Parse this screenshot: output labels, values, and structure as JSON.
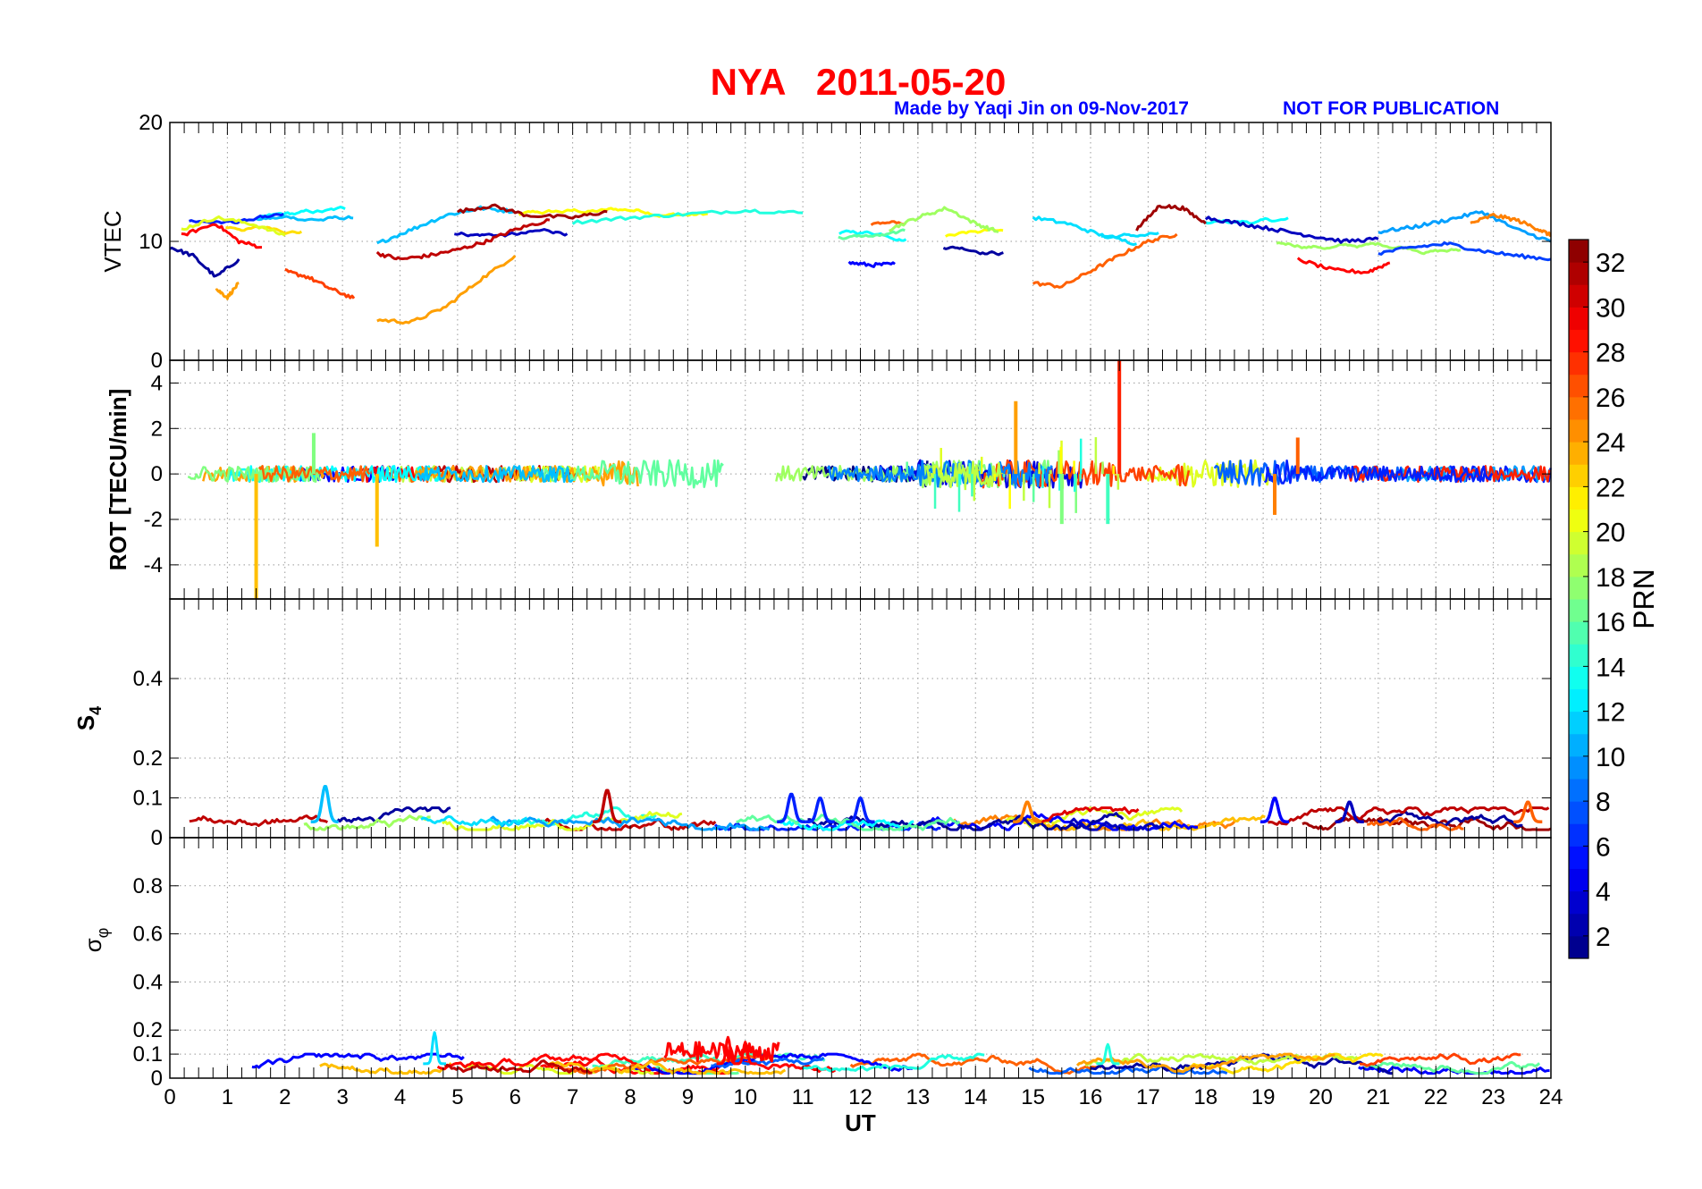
{
  "figure": {
    "title": "NYA   2011-05-20",
    "credit": "Made by Yaqi Jin on 09-Nov-2017",
    "notice": "NOT FOR PUBLICATION",
    "title_color": "#ff0000",
    "credit_color": "#0000ff"
  },
  "colorbar": {
    "label": "PRN",
    "range": [
      1,
      33
    ],
    "ticks": [
      "2",
      "4",
      "6",
      "8",
      "10",
      "12",
      "14",
      "16",
      "18",
      "20",
      "22",
      "24",
      "26",
      "28",
      "30",
      "32"
    ],
    "colormap": "jet"
  },
  "chart_data": [
    {
      "type": "line",
      "panel": "vtec",
      "ylabel": "VTEC",
      "ylim": [
        0,
        20
      ],
      "yticks": [
        "0",
        "10",
        "20"
      ],
      "xlim": [
        0,
        24
      ],
      "grid": true,
      "series": [
        {
          "prn": 2,
          "x": [
            0.0,
            0.4,
            0.8,
            1.2
          ],
          "y": [
            9.5,
            8.8,
            7.0,
            8.5
          ]
        },
        {
          "prn": 5,
          "x": [
            11.8,
            12.2,
            12.6
          ],
          "y": [
            8.2,
            8.0,
            8.1
          ]
        },
        {
          "prn": 11,
          "x": [
            3.6,
            4.2,
            4.8,
            5.4,
            6.0
          ],
          "y": [
            9.8,
            11.0,
            12.2,
            12.8,
            12.5
          ]
        },
        {
          "prn": 14,
          "x": [
            7.0,
            8.0,
            9.0,
            10.0,
            11.0
          ],
          "y": [
            11.6,
            12.0,
            12.3,
            12.6,
            12.4
          ]
        },
        {
          "prn": 20,
          "x": [
            0.2,
            0.8,
            1.4,
            2.0
          ],
          "y": [
            11.0,
            12.0,
            11.5,
            10.5
          ]
        },
        {
          "prn": 24,
          "x": [
            3.6,
            4.2,
            4.8,
            5.4,
            6.0
          ],
          "y": [
            3.4,
            3.2,
            4.5,
            6.8,
            8.8
          ]
        },
        {
          "prn": 24,
          "x": [
            0.8,
            1.0,
            1.2
          ],
          "y": [
            6.0,
            5.3,
            6.5
          ]
        },
        {
          "prn": 27,
          "x": [
            2.0,
            2.4,
            2.8,
            3.2
          ],
          "y": [
            7.5,
            7.0,
            6.0,
            5.2
          ]
        },
        {
          "prn": 29,
          "x": [
            0.2,
            0.8,
            1.2,
            1.6
          ],
          "y": [
            10.5,
            11.5,
            10.0,
            9.5
          ]
        },
        {
          "prn": 31,
          "x": [
            3.6,
            4.0,
            4.5,
            5.0,
            5.5,
            6.0,
            6.6
          ],
          "y": [
            9.0,
            8.5,
            8.8,
            9.3,
            10.0,
            11.0,
            11.8
          ]
        },
        {
          "prn": 32,
          "x": [
            5.0,
            5.6,
            6.2,
            7.0,
            7.6
          ],
          "y": [
            12.5,
            13.0,
            12.2,
            12.0,
            12.5
          ]
        },
        {
          "prn": 26,
          "x": [
            15.0,
            15.5,
            16.0,
            16.5,
            17.0,
            17.5
          ],
          "y": [
            6.5,
            6.2,
            7.5,
            8.8,
            10.0,
            10.6
          ]
        },
        {
          "prn": 18,
          "x": [
            12.5,
            13.0,
            13.5,
            14.0,
            14.4
          ],
          "y": [
            11.0,
            12.0,
            12.8,
            11.5,
            10.8
          ]
        },
        {
          "prn": 12,
          "x": [
            15.0,
            15.6,
            16.2,
            16.8
          ],
          "y": [
            12.0,
            11.5,
            10.5,
            9.8
          ]
        },
        {
          "prn": 3,
          "x": [
            18.0,
            18.6,
            19.2,
            19.8,
            20.4,
            21.0
          ],
          "y": [
            12.0,
            11.5,
            11.0,
            10.5,
            10.0,
            10.2
          ]
        },
        {
          "prn": 29,
          "x": [
            19.6,
            20.2,
            20.8,
            21.2
          ],
          "y": [
            8.5,
            7.6,
            7.4,
            8.2
          ]
        },
        {
          "prn": 10,
          "x": [
            21.0,
            21.6,
            22.2,
            22.8,
            23.4,
            24.0
          ],
          "y": [
            10.8,
            11.2,
            11.8,
            12.5,
            11.0,
            10.0
          ]
        },
        {
          "prn": 25,
          "x": [
            22.6,
            23.0,
            23.4,
            23.8,
            24.0
          ],
          "y": [
            11.5,
            12.2,
            11.8,
            11.0,
            10.5
          ]
        },
        {
          "prn": 7,
          "x": [
            21.0,
            21.6,
            22.2,
            22.8,
            23.4,
            24.0
          ],
          "y": [
            9.0,
            9.5,
            9.8,
            9.2,
            8.8,
            8.5
          ]
        },
        {
          "prn": 32,
          "x": [
            16.8,
            17.2,
            17.6,
            18.0
          ],
          "y": [
            11.0,
            13.0,
            12.8,
            11.5
          ]
        }
      ]
    },
    {
      "type": "line",
      "panel": "rot",
      "ylabel": "ROT [TECU/min]",
      "ylim": [
        -5.5,
        5.0
      ],
      "yticks": [
        "-4",
        "-2",
        "0",
        "2",
        "4"
      ],
      "xlim": [
        0,
        24
      ],
      "grid": true,
      "spikes": [
        {
          "prn": 23,
          "x": 1.5,
          "y": -5.5
        },
        {
          "prn": 23,
          "x": 3.6,
          "y": -3.2
        },
        {
          "prn": 24,
          "x": 14.7,
          "y": 3.2
        },
        {
          "prn": 28,
          "x": 16.5,
          "y": 5.0
        },
        {
          "prn": 17,
          "x": 2.5,
          "y": 1.8
        },
        {
          "prn": 17,
          "x": 15.5,
          "y": -2.2
        },
        {
          "prn": 15,
          "x": 16.3,
          "y": -2.2
        },
        {
          "prn": 25,
          "x": 19.2,
          "y": -1.8
        },
        {
          "prn": 26,
          "x": 19.6,
          "y": 1.6
        }
      ]
    },
    {
      "type": "line",
      "panel": "s4",
      "ylabel": "S4",
      "ylim": [
        0,
        0.6
      ],
      "yticks": [
        "0",
        "0.1",
        "0.2",
        "0.4"
      ],
      "xlim": [
        0,
        24
      ],
      "grid": true,
      "bumps": [
        {
          "prn": 11,
          "x": 2.7,
          "y": 0.13
        },
        {
          "prn": 31,
          "x": 7.6,
          "y": 0.12
        },
        {
          "prn": 6,
          "x": 10.8,
          "y": 0.11
        },
        {
          "prn": 6,
          "x": 11.3,
          "y": 0.1
        },
        {
          "prn": 6,
          "x": 12.0,
          "y": 0.1
        },
        {
          "prn": 25,
          "x": 14.9,
          "y": 0.09
        },
        {
          "prn": 5,
          "x": 19.2,
          "y": 0.1
        },
        {
          "prn": 3,
          "x": 20.5,
          "y": 0.09
        },
        {
          "prn": 26,
          "x": 23.6,
          "y": 0.09
        }
      ]
    },
    {
      "type": "line",
      "panel": "sigma_phi",
      "ylabel": "σφ",
      "ylim": [
        0,
        1
      ],
      "yticks": [
        "0",
        "0.1",
        "0.2",
        "0.4",
        "0.6",
        "0.8"
      ],
      "xlim": [
        0,
        24
      ],
      "xlabel": "UT",
      "xticks": [
        "0",
        "1",
        "2",
        "3",
        "4",
        "5",
        "6",
        "7",
        "8",
        "9",
        "10",
        "11",
        "12",
        "13",
        "14",
        "15",
        "16",
        "17",
        "18",
        "19",
        "20",
        "21",
        "22",
        "23",
        "24"
      ],
      "grid": true,
      "bumps": [
        {
          "prn": 12,
          "x": 4.6,
          "y": 0.19
        },
        {
          "prn": 29,
          "x": 9.7,
          "y": 0.17
        },
        {
          "prn": 29,
          "x": 10.0,
          "y": 0.15
        },
        {
          "prn": 14,
          "x": 16.3,
          "y": 0.14
        }
      ]
    }
  ]
}
